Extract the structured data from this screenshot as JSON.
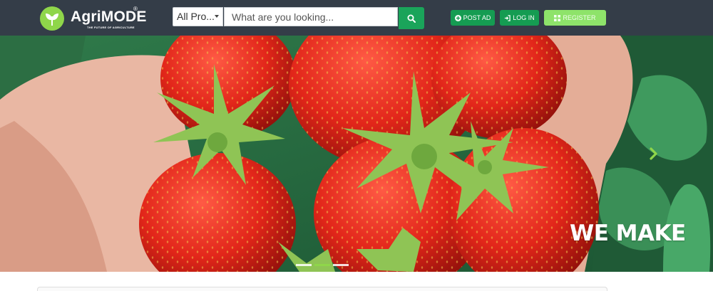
{
  "brand": {
    "name": "AgriMODE",
    "registered_mark": "®",
    "tagline": "THE FUTURE OF AGRICULTURE",
    "accent_color": "#8fd64a"
  },
  "search": {
    "category_selected": "All Pro...",
    "placeholder": "What are you looking...",
    "value": "",
    "button_icon": "search-icon"
  },
  "nav_buttons": {
    "post_ad": {
      "label": "POST AD",
      "icon": "plus-circle-icon",
      "color": "#159c52"
    },
    "login": {
      "label": "LOG IN",
      "icon": "sign-in-icon",
      "color": "#159c52"
    },
    "register": {
      "label": "REGISTER",
      "icon": "grid-icon",
      "color": "#8ee36a"
    }
  },
  "hero": {
    "caption": "WE MAKE",
    "image_subject": "hands-holding-strawberries",
    "next_icon": "chevron-right-icon",
    "slides": [
      "slide-1",
      "slide-2",
      "slide-3"
    ],
    "active_slide": 2
  },
  "colors": {
    "navbar_bg": "#343d48",
    "primary_green": "#1aa45a"
  }
}
